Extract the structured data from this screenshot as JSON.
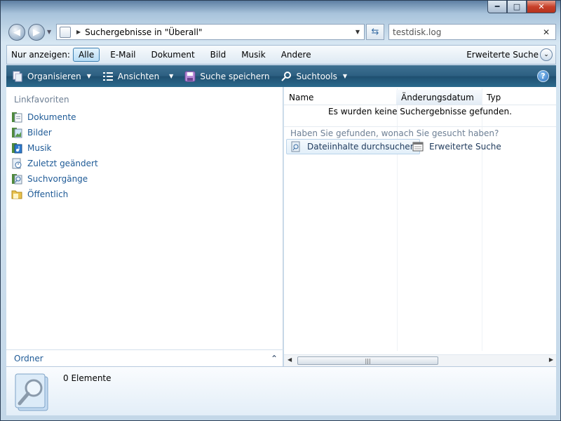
{
  "window": {
    "buttons": {
      "minimize": "━",
      "maximize": "□",
      "close": "✕"
    }
  },
  "address": {
    "path": "Suchergebnisse in \"Überall\""
  },
  "search": {
    "value": "testdisk.log"
  },
  "filter_bar": {
    "label": "Nur anzeigen:",
    "filters": [
      "Alle",
      "E-Mail",
      "Dokument",
      "Bild",
      "Musik",
      "Andere"
    ],
    "active": "Alle",
    "advanced": "Erweiterte Suche"
  },
  "toolbar": {
    "organize": "Organisieren",
    "views": "Ansichten",
    "save_search": "Suche speichern",
    "search_tools": "Suchtools",
    "help": "?"
  },
  "nav": {
    "heading": "Linkfavoriten",
    "items": [
      {
        "label": "Dokumente",
        "icon": "documents-icon"
      },
      {
        "label": "Bilder",
        "icon": "pictures-icon"
      },
      {
        "label": "Musik",
        "icon": "music-icon"
      },
      {
        "label": "Zuletzt geändert",
        "icon": "recent-icon"
      },
      {
        "label": "Suchvorgänge",
        "icon": "searches-icon"
      },
      {
        "label": "Öffentlich",
        "icon": "public-folder-icon"
      }
    ],
    "folders": "Ordner"
  },
  "results": {
    "columns": [
      "Name",
      "Änderungsdatum",
      "Typ"
    ],
    "empty_message": "Es wurden keine Suchergebnisse gefunden.",
    "found_question": "Haben Sie gefunden, wonach Sie gesucht haben?",
    "actions": {
      "search_contents": "Dateiinhalte durchsuchen",
      "advanced_search": "Erweiterte Suche"
    }
  },
  "details": {
    "count": "0 Elemente"
  },
  "colors": {
    "toolbar": "#2c5f81",
    "link": "#1e5a96",
    "accent": "#3c7fb1"
  }
}
